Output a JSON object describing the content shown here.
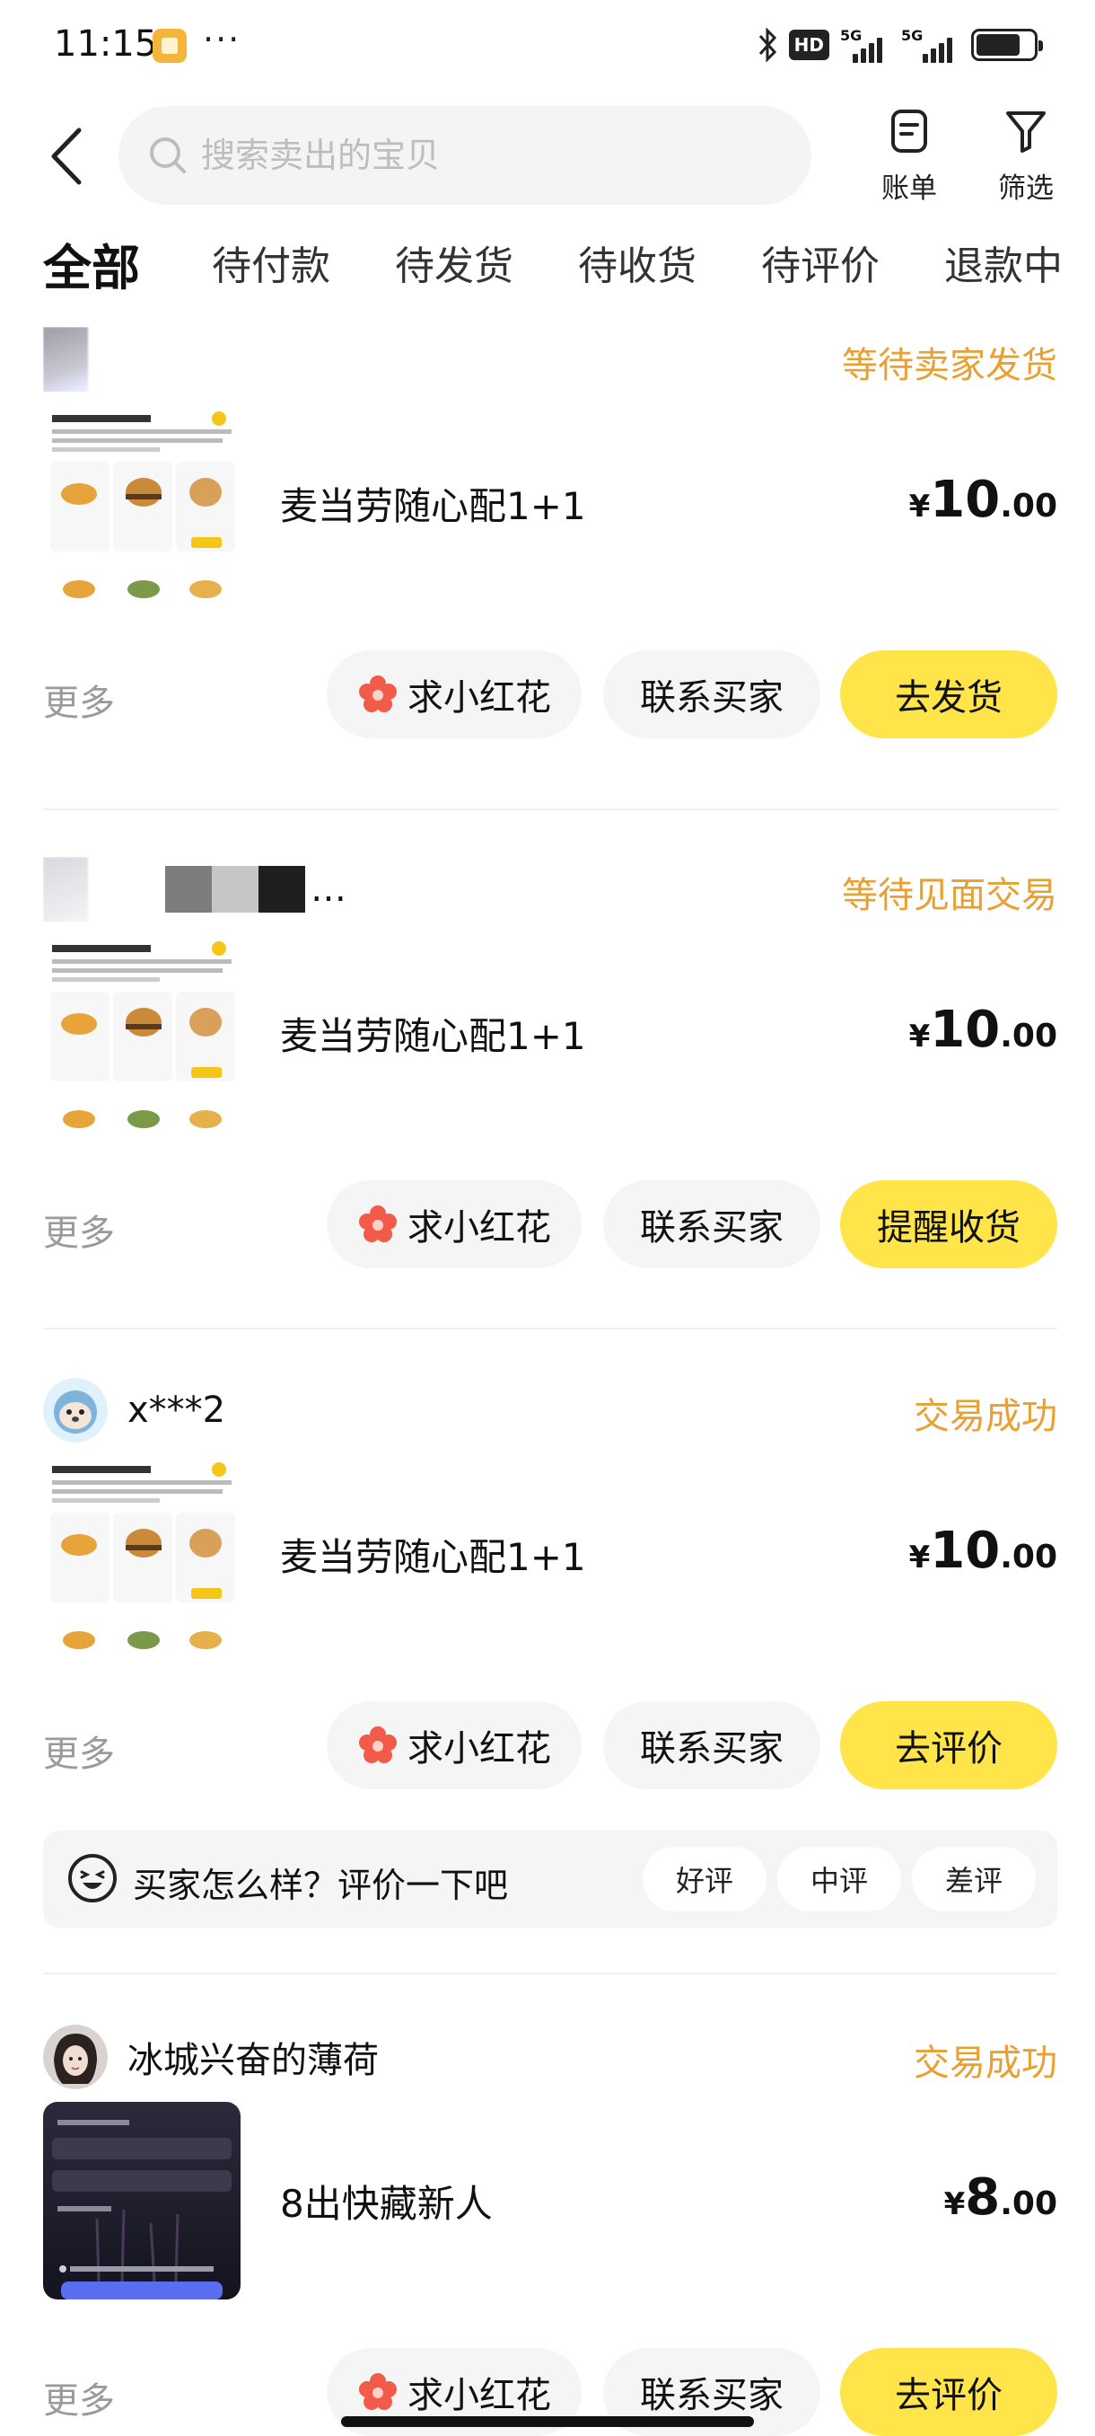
{
  "status_bar": {
    "time": "11:15",
    "dots": "···",
    "hd": "HD",
    "net1": "5G",
    "net2": "5G"
  },
  "header": {
    "search_placeholder": "搜索卖出的宝贝",
    "bill_label": "账单",
    "filter_label": "筛选"
  },
  "tabs": [
    "全部",
    "待付款",
    "待发货",
    "待收货",
    "待评价",
    "退款中"
  ],
  "orders": [
    {
      "buyer": "",
      "status": "等待卖家发货",
      "title": "麦当劳随心配1+1",
      "price": {
        "currency": "¥",
        "int": "10",
        "dec": ".00"
      },
      "more": "更多",
      "flower": "求小红花",
      "contact": "联系买家",
      "primary": "去发货"
    },
    {
      "buyer": "…",
      "status": "等待见面交易",
      "title": "麦当劳随心配1+1",
      "price": {
        "currency": "¥",
        "int": "10",
        "dec": ".00"
      },
      "more": "更多",
      "flower": "求小红花",
      "contact": "联系买家",
      "primary": "提醒收货"
    },
    {
      "buyer": "x***2",
      "status": "交易成功",
      "title": "麦当劳随心配1+1",
      "price": {
        "currency": "¥",
        "int": "10",
        "dec": ".00"
      },
      "more": "更多",
      "flower": "求小红花",
      "contact": "联系买家",
      "primary": "去评价",
      "review": {
        "prompt": "买家怎么样？评价一下吧",
        "good": "好评",
        "neutral": "中评",
        "bad": "差评"
      }
    },
    {
      "buyer": "冰城兴奋的薄荷",
      "status": "交易成功",
      "title": "8出快藏新人",
      "price": {
        "currency": "¥",
        "int": "8",
        "dec": ".00"
      },
      "more": "更多",
      "flower": "求小红花",
      "contact": "联系买家",
      "primary": "去评价"
    }
  ],
  "colors": {
    "accent_yellow": "#ffe44a",
    "status_orange": "#e8a032",
    "pill_gray": "#f5f5f6",
    "flower_red": "#f25a4a"
  }
}
